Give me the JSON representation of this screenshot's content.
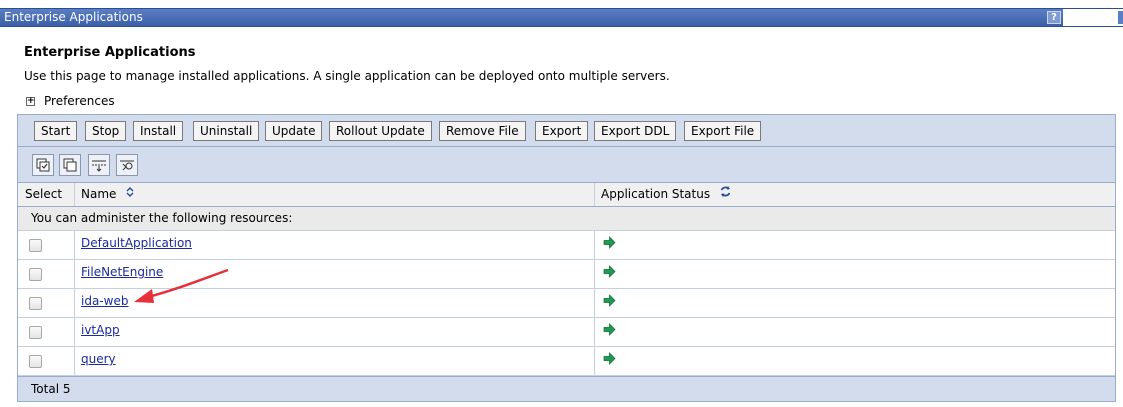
{
  "window": {
    "title": "Enterprise Applications",
    "help_label": "?"
  },
  "page": {
    "heading": "Enterprise Applications",
    "description": "Use this page to manage installed applications. A single application can be deployed onto multiple servers.",
    "preferences_label": "Preferences"
  },
  "toolbar": {
    "buttons": [
      "Start",
      "Stop",
      "Install",
      "Uninstall",
      "Update",
      "Rollout Update",
      "Remove File",
      "Export",
      "Export DDL",
      "Export File"
    ]
  },
  "icon_toolbar": {
    "icons": [
      "select-all-icon",
      "deselect-all-icon",
      "show-filter-icon",
      "clear-filter-icon"
    ]
  },
  "table": {
    "columns": {
      "select": "Select",
      "name": "Name",
      "status": "Application Status"
    },
    "group_message": "You can administer the following resources:",
    "rows": [
      {
        "name": "DefaultApplication",
        "status_icon": "started-arrow-icon"
      },
      {
        "name": "FileNetEngine",
        "status_icon": "started-arrow-icon"
      },
      {
        "name": "ida-web",
        "status_icon": "started-arrow-icon"
      },
      {
        "name": "ivtApp",
        "status_icon": "started-arrow-icon"
      },
      {
        "name": "query",
        "status_icon": "started-arrow-icon"
      }
    ],
    "total": "Total 5"
  },
  "colors": {
    "title_bar": "#3b5fa8",
    "link": "#1a2a9f",
    "status_arrow": "#1e9a52",
    "annotation_arrow": "#e8303a"
  }
}
